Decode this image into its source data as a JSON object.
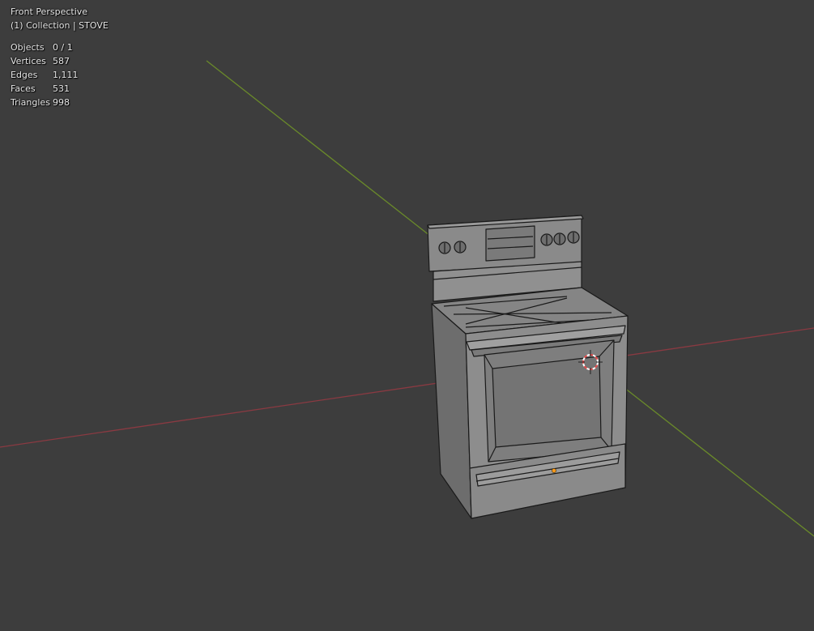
{
  "viewport": {
    "view_name": "Front Perspective",
    "collection": "(1) Collection | STOVE",
    "stats": [
      {
        "label": "Objects",
        "value": "0 / 1"
      },
      {
        "label": "Vertices",
        "value": "587"
      },
      {
        "label": "Edges",
        "value": "1,111"
      },
      {
        "label": "Faces",
        "value": "531"
      },
      {
        "label": "Triangles",
        "value": "998"
      }
    ]
  },
  "colors": {
    "background": "#3d3d3d",
    "x_axis": "#8a3a42",
    "y_axis": "#6a8a2a",
    "mesh_face": "#808080",
    "mesh_wire": "#1a1a1a",
    "origin_dot": "#ff9a1a",
    "cursor": "#e44a4a"
  },
  "icons": {
    "cursor": "3d-cursor-icon",
    "origin": "object-origin-icon"
  }
}
